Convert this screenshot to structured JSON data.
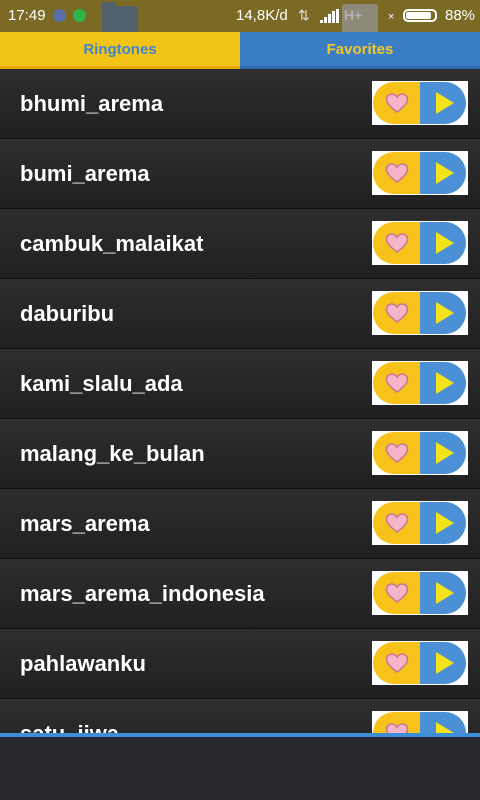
{
  "status_bar": {
    "time": "17:49",
    "speed": "14,8K/d",
    "network": "H+",
    "battery_percent": "88%",
    "battery_level": 0.88
  },
  "tabs": [
    {
      "label": "Ringtones",
      "active": true
    },
    {
      "label": "Favorites",
      "active": false
    }
  ],
  "ringtones": [
    "bhumi_arema",
    "bumi_arema",
    "cambuk_malaikat",
    "daburibu",
    "kami_slalu_ada",
    "malang_ke_bulan",
    "mars_arema",
    "mars_arema_indonesia",
    "pahlawanku",
    "satu_jiwa"
  ],
  "colors": {
    "tab_active_bg": "#f2c418",
    "tab_inactive_bg": "#3a7ec6",
    "favorite_button": "#f7c31b",
    "play_button": "#4b8fd6",
    "heart": "#f5b5c8",
    "play_triangle": "#f3e31c"
  },
  "icons": {
    "favorite": "heart-icon",
    "play": "play-icon"
  }
}
